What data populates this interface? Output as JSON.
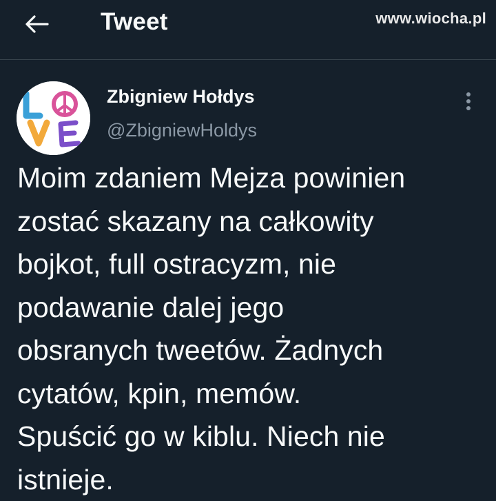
{
  "header": {
    "title": "Tweet",
    "back_icon": "arrow-left-icon"
  },
  "watermark": "www.wiocha.pl",
  "tweet": {
    "author_name": "Zbigniew Hołdys",
    "author_handle": "@ZbigniewHoldys",
    "avatar_text": "LOVE",
    "more_icon": "more-vertical-icon",
    "text": "Moim zdaniem Mejza powinien\nzostać skazany na całkowity\nbojkot, full ostracyzm, nie\npodawanie dalej jego\nobsranych tweetów. Żadnych\ncytatów, kpin, memów.\nSpuścić go w kiblu. Niech nie\nistnieje."
  },
  "colors": {
    "background": "#15202b",
    "text": "#f7f9f9",
    "secondary_text": "#8b98a5",
    "divider": "#38444d"
  }
}
